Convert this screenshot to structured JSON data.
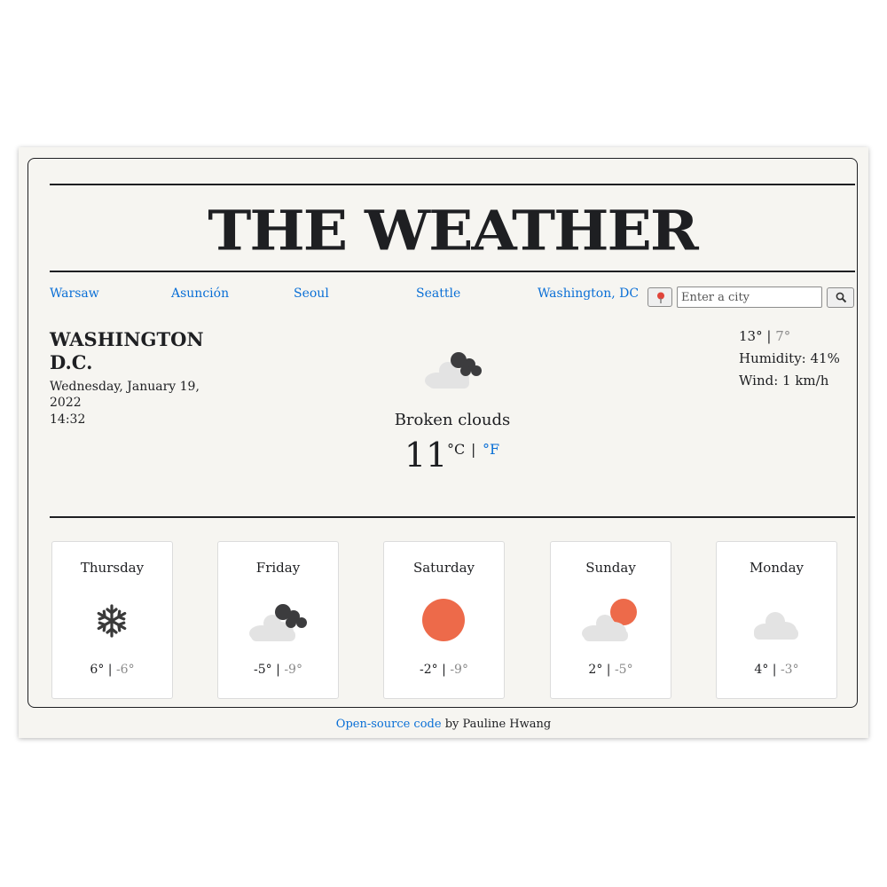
{
  "header": {
    "title": "THE WEATHER"
  },
  "quick_cities": [
    "Warsaw",
    "Asunción",
    "Seoul",
    "Seattle",
    "Washington, DC"
  ],
  "search": {
    "placeholder": "Enter a city",
    "value": "",
    "location_icon": "map-pin-icon",
    "search_icon": "magnifier-icon"
  },
  "current": {
    "city_line1": "WASHINGTON",
    "city_line2": "D.C.",
    "date": "Wednesday, January 19, 2022",
    "time": "14:32",
    "icon": "broken-clouds-icon",
    "description": "Broken clouds",
    "temperature": "11",
    "unit_celsius": "°C",
    "unit_separator": "|",
    "unit_fahrenheit": "°F",
    "high": "13°",
    "low": "7°",
    "humidity": "Humidity: 41%",
    "wind": "Wind: 1 km/h"
  },
  "forecast": [
    {
      "day": "Thursday",
      "icon": "snowflake-icon",
      "high": "6°",
      "low": "-6°"
    },
    {
      "day": "Friday",
      "icon": "broken-clouds-icon",
      "high": "-5°",
      "low": "-9°"
    },
    {
      "day": "Saturday",
      "icon": "sun-icon",
      "high": "-2°",
      "low": "-9°"
    },
    {
      "day": "Sunday",
      "icon": "partly-sunny-icon",
      "high": "2°",
      "low": "-5°"
    },
    {
      "day": "Monday",
      "icon": "cloud-icon",
      "high": "4°",
      "low": "-3°"
    }
  ],
  "footer": {
    "link_text": "Open-source code",
    "suffix": " by Pauline Hwang"
  },
  "colors": {
    "accent": "#0a6fd6",
    "sun": "#ed6a4a",
    "dark_cloud": "#3c3c3e",
    "light_cloud": "#e3e3e3",
    "background": "#f6f5f1"
  }
}
